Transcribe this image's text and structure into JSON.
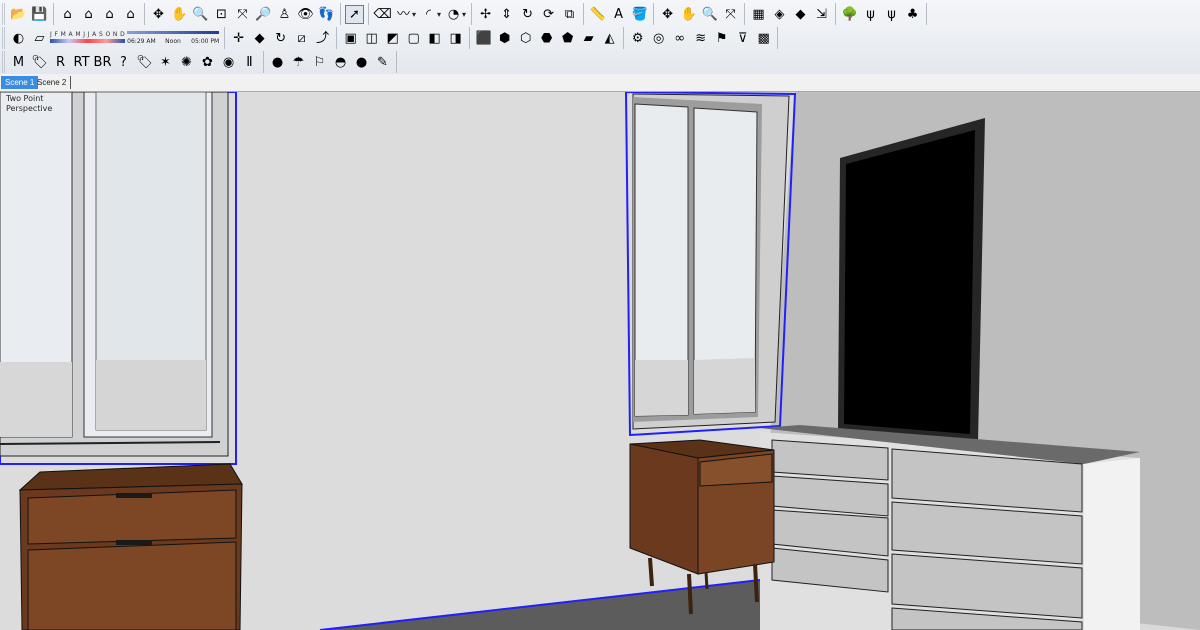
{
  "toolbar_row1": [
    {
      "name": "open-model-icon",
      "glyph": "📂"
    },
    {
      "name": "save-model-icon",
      "glyph": "💾"
    },
    {
      "name": "house-icon",
      "glyph": "⌂"
    },
    {
      "name": "house-front-icon",
      "glyph": "⌂"
    },
    {
      "name": "house-outline-icon",
      "glyph": "⌂"
    },
    {
      "name": "house-side-icon",
      "glyph": "⌂"
    },
    {
      "name": "orbit-icon",
      "glyph": "✥"
    },
    {
      "name": "pan-hand-icon",
      "glyph": "✋"
    },
    {
      "name": "zoom-icon",
      "glyph": "🔍"
    },
    {
      "name": "zoom-window-icon",
      "glyph": "⊡"
    },
    {
      "name": "zoom-extents-icon",
      "glyph": "⤧"
    },
    {
      "name": "previous-view-icon",
      "glyph": "🔎"
    },
    {
      "name": "position-camera-icon",
      "glyph": "♙"
    },
    {
      "name": "look-around-icon",
      "glyph": "👁"
    },
    {
      "name": "walk-footprints-icon",
      "glyph": "👣"
    },
    {
      "name": "select-arrow-icon",
      "glyph": "➚",
      "selected": true
    },
    {
      "name": "eraser-icon",
      "glyph": "⌫"
    },
    {
      "name": "freehand-icon",
      "glyph": "〰",
      "dropdown": true
    },
    {
      "name": "arc-icon",
      "glyph": "◜",
      "dropdown": true
    },
    {
      "name": "protractor-icon",
      "glyph": "◔",
      "dropdown": true
    },
    {
      "name": "move-icon",
      "glyph": "✢"
    },
    {
      "name": "push-pull-icon",
      "glyph": "⇕"
    },
    {
      "name": "rotate-icon",
      "glyph": "↻"
    },
    {
      "name": "follow-me-icon",
      "glyph": "⟳"
    },
    {
      "name": "offset-icon",
      "glyph": "⧉"
    },
    {
      "name": "tape-measure-icon",
      "glyph": "📏"
    },
    {
      "name": "text-tool-icon",
      "glyph": "A"
    },
    {
      "name": "paint-bucket-icon",
      "glyph": "🪣"
    },
    {
      "name": "orbit-2-icon",
      "glyph": "✥"
    },
    {
      "name": "pan-2-icon",
      "glyph": "✋"
    },
    {
      "name": "zoom-2-icon",
      "glyph": "🔍"
    },
    {
      "name": "zoom-extents-2-icon",
      "glyph": "⤧"
    },
    {
      "name": "components-icon",
      "glyph": "▦"
    },
    {
      "name": "materials-icon",
      "glyph": "◈"
    },
    {
      "name": "styles-icon",
      "glyph": "◆"
    },
    {
      "name": "export-icon",
      "glyph": "⇲"
    },
    {
      "name": "tree-icon",
      "glyph": "🌳"
    },
    {
      "name": "grass-icon",
      "glyph": "ψ"
    },
    {
      "name": "plant-icon",
      "glyph": "ψ"
    },
    {
      "name": "bush-icon",
      "glyph": "♣"
    }
  ],
  "toolbar_row2": {
    "left_icons": [
      {
        "name": "shadows-toggle-icon",
        "glyph": "◐"
      },
      {
        "name": "fog-icon",
        "glyph": "▱"
      }
    ],
    "months": "J F M A M J J A S O N D",
    "time_start": "06:29 AM",
    "time_noon": "Noon",
    "time_end": "05:00 PM",
    "icons": [
      {
        "name": "axes-icon",
        "glyph": "✛"
      },
      {
        "name": "section-plane-icon",
        "glyph": "◆"
      },
      {
        "name": "refresh-icon",
        "glyph": "↻"
      },
      {
        "name": "section-cut-icon",
        "glyph": "⧄"
      },
      {
        "name": "sandbox-icon",
        "glyph": "⤴"
      },
      {
        "name": "box-view-icon",
        "glyph": "▣"
      },
      {
        "name": "xray-icon",
        "glyph": "◫"
      },
      {
        "name": "back-edges-icon",
        "glyph": "◩"
      },
      {
        "name": "wireframe-icon",
        "glyph": "▢"
      },
      {
        "name": "hidden-line-icon",
        "glyph": "◧"
      },
      {
        "name": "shaded-icon",
        "glyph": "◨"
      },
      {
        "name": "textured-icon",
        "glyph": "⬛"
      },
      {
        "name": "iso-view-icon",
        "glyph": "⬢"
      },
      {
        "name": "top-view-icon",
        "glyph": "⬡"
      },
      {
        "name": "front-view-icon",
        "glyph": "⬣"
      },
      {
        "name": "right-view-icon",
        "glyph": "⬟"
      },
      {
        "name": "back-view-icon",
        "glyph": "▰"
      },
      {
        "name": "left-view-icon",
        "glyph": "◭"
      },
      {
        "name": "film-reel-icon",
        "glyph": "⚙"
      },
      {
        "name": "spiral-icon",
        "glyph": "◎"
      },
      {
        "name": "knot-icon",
        "glyph": "∞"
      },
      {
        "name": "twist-icon",
        "glyph": "≋"
      },
      {
        "name": "flag-icon",
        "glyph": "⚑"
      },
      {
        "name": "bucket-icon",
        "glyph": "⊽"
      },
      {
        "name": "grid-box-icon",
        "glyph": "▩"
      }
    ]
  },
  "toolbar_row3": [
    {
      "name": "plugin-m-icon",
      "glyph": "M"
    },
    {
      "name": "tag-icon",
      "glyph": "🏷"
    },
    {
      "name": "plugin-r-icon",
      "glyph": "R"
    },
    {
      "name": "plugin-rt-icon",
      "glyph": "RT"
    },
    {
      "name": "plugin-br-icon",
      "glyph": "BR"
    },
    {
      "name": "help-icon",
      "glyph": "?"
    },
    {
      "name": "tag-2-icon",
      "glyph": "🏷"
    },
    {
      "name": "light-rays-icon",
      "glyph": "✶"
    },
    {
      "name": "lamp-icon",
      "glyph": "✺"
    },
    {
      "name": "plant-2-icon",
      "glyph": "✿"
    },
    {
      "name": "render-globe-icon",
      "glyph": "◉"
    },
    {
      "name": "pause-icon",
      "glyph": "Ⅱ"
    },
    {
      "name": "omni-light-icon",
      "glyph": "●"
    },
    {
      "name": "spot-light-icon",
      "glyph": "☂"
    },
    {
      "name": "flag-light-icon",
      "glyph": "⚐"
    },
    {
      "name": "dome-light-icon",
      "glyph": "◓"
    },
    {
      "name": "sphere-light-icon",
      "glyph": "●"
    },
    {
      "name": "mesh-light-icon",
      "glyph": "✎"
    }
  ],
  "tabs": [
    "Scene 1",
    "Scene 2"
  ],
  "camera_label_line1": "Two Point",
  "camera_label_line2": "Perspective",
  "colors": {
    "wall_left": "#dcdcdc",
    "wall_right": "#bdbdbd",
    "floor": "#5e5e5e",
    "wood": "#6b3a1e",
    "selection": "#2020ff",
    "dresser": "#d9d9d9",
    "screen": "#000000"
  }
}
